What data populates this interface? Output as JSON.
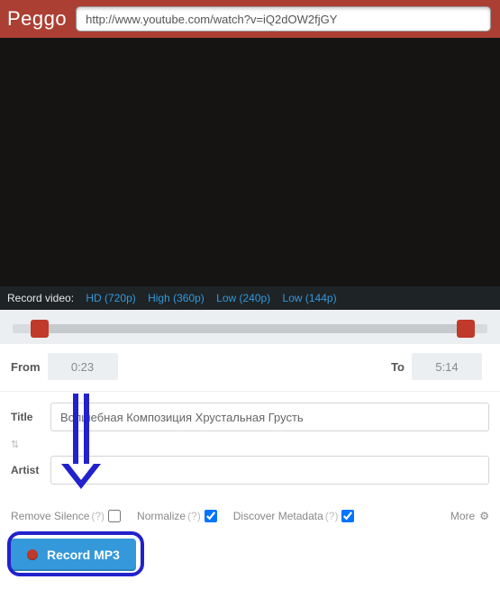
{
  "header": {
    "logo": "Peggo",
    "url": "http://www.youtube.com/watch?v=iQ2dOW2fjGY"
  },
  "record_video": {
    "label": "Record video:",
    "links": [
      "HD (720p)",
      "High (360p)",
      "Low (240p)",
      "Low (144p)"
    ]
  },
  "trim": {
    "from_label": "From",
    "from_value": "0:23",
    "to_label": "To",
    "to_value": "5:14"
  },
  "meta": {
    "title_label": "Title",
    "title_value": "Волшебная Композиция Хрустальная Грусть",
    "swap_icon": "⇅",
    "artist_label": "Artist",
    "artist_value": ""
  },
  "options": {
    "remove_silence": {
      "label": "Remove Silence",
      "help": "(?)",
      "checked": false
    },
    "normalize": {
      "label": "Normalize",
      "help": "(?)",
      "checked": true
    },
    "discover_metadata": {
      "label": "Discover Metadata",
      "help": "(?)",
      "checked": true
    },
    "more_label": "More",
    "gear_icon": "⚙"
  },
  "action": {
    "record_mp3": "Record MP3"
  }
}
